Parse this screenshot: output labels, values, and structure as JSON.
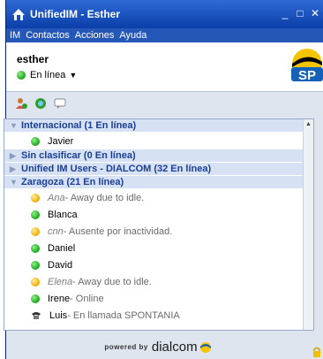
{
  "window": {
    "title": "UnifiedIM - Esther"
  },
  "menu": [
    "IM",
    "Contactos",
    "Acciones",
    "Ayuda"
  ],
  "profile": {
    "username": "esther",
    "status": "En línea"
  },
  "groups": [
    {
      "label": "Internacional (1 En línea)",
      "expanded": true,
      "contacts": [
        {
          "name": "Javier",
          "status": "online"
        }
      ]
    },
    {
      "label": "Sin clasificar (0 En línea)",
      "expanded": false,
      "contacts": []
    },
    {
      "label": "Unified IM Users - DIALCOM (32 En línea)",
      "expanded": false,
      "contacts": []
    },
    {
      "label": "Zaragoza (21 En línea)",
      "expanded": true,
      "contacts": [
        {
          "name": "Ana",
          "status": "away",
          "message": " - Away due to idle."
        },
        {
          "name": "Blanca",
          "status": "online"
        },
        {
          "name": "cnn",
          "status": "away",
          "message": " - Ausente por inactividad."
        },
        {
          "name": "Daniel",
          "status": "online"
        },
        {
          "name": "David",
          "status": "online"
        },
        {
          "name": "Elena",
          "status": "away",
          "message": " - Away due to idle."
        },
        {
          "name": "Irene",
          "status": "online",
          "message": " - Online"
        },
        {
          "name": "Luis",
          "status": "phone",
          "message": " - En llamada SPONTANIA"
        }
      ]
    }
  ],
  "footer": {
    "powered": "powered by",
    "brand": "dialcom"
  }
}
